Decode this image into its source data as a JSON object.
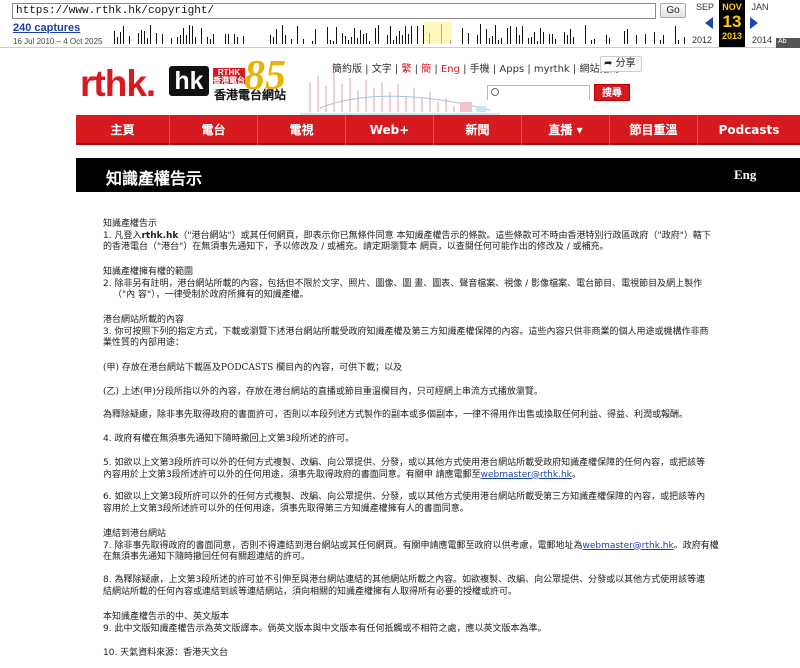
{
  "wayback": {
    "url": "https://www.rthk.hk/copyright/",
    "go_label": "Go",
    "captures": "240 captures",
    "range": "16 Jul 2010 – 4 Oct 2025",
    "prev_month": "SEP",
    "current_month": "NOV",
    "next_month": "JAN",
    "prev_year": "2012",
    "current_day": "13",
    "current_year": "2013",
    "next_year": "2014",
    "about_label": "Ab"
  },
  "header": {
    "logo_text": "rthk.",
    "logo_hk": "hk",
    "logo_badge": "RTHK 香港電台",
    "logo_zh": "香港電台網站",
    "anniversary": "85",
    "toplinks": [
      "簡約版",
      "文字",
      "繁",
      "簡",
      "Eng",
      "手機",
      "Apps",
      "myrthk",
      "網站指南"
    ],
    "share_label": "分享",
    "search_placeholder": "",
    "search_button": "搜尋"
  },
  "nav": [
    {
      "label": "主頁"
    },
    {
      "label": "電台"
    },
    {
      "label": "電視"
    },
    {
      "label": "Web+"
    },
    {
      "label": "新聞"
    },
    {
      "label": "直播 ▾"
    },
    {
      "label": "節目重溫"
    },
    {
      "label": "Podcasts"
    }
  ],
  "page": {
    "title": "知識產權告示",
    "eng_link": "Eng"
  },
  "content": {
    "s1_head": "知識產權告示",
    "s1_line1_pre": "1. 凡登入",
    "s1_line1_bold": "rthk.hk",
    "s1_line1_post": "（\"港台網站\"）或其任何網頁，即表示你已無條件同意 本知識產權告示的條款。這些條款可不時由香港特別行政區政府（\"政府\"）轄下",
    "s1_line2": "的香港電台（\"港台\"）在無須事先通知下，予以修改及 / 或補充。請定期瀏覽本 網頁，以查閱任何可能作出的修改及 / 或補充。",
    "s2_head": "知識產權擁有權的範圍",
    "s2_line1": "2. 除非另有註明，港台網站所載的內容，包括但不限於文字、照片、圖像、圖 畫、圖表、聲音檔案、視像 / 影像檔案、電台節目、電視節目及網上製作",
    "s2_line2": "（\"內 容\"），一律受制於政府所擁有的知識產權。",
    "s3_head": "港台網站所載的內容",
    "s3_line1": "3. 你可按照下列的指定方式，下載或瀏覽下述港台網站所載受政府知識產權及第三方知識產權保障的內容。這些內容只供非商業的個人用途或機構作非商",
    "s3_line2": "業性質的內部用途：",
    "s3_a": "(甲) 存放在港台網站下載區及PODCASTS 欄目內的內容，可供下載；以及",
    "s3_b": "(乙) 上述(甲)分段所指以外的內容，存放在港台網站的直播或節目重溫欄目內，只可經網上串流方式播放瀏覽。",
    "s3_c": "為釋除疑慮，除非事先取得政府的書面許可，否則以本段列述方式製作的副本或多個副本，一律不得用作出售或換取任何利益、得益、利潤或報酬。",
    "s4": "4. 政府有權在無須事先通知下隨時撤回上文第3段所述的許可。",
    "s5_line1": "5. 如欲以上文第3段所許可以外的任何方式複製、改編、向公眾提供、分發，或以其他方式使用港台網站所載受政府知識產權保障的任何內容，或把該等",
    "s5_line2_pre": "內容用於上文第3段所述許可以外的任何用途，須事先取得政府的書面同意。有關申 請應電郵至",
    "s5_email": "webmaster@rthk.hk",
    "s5_line2_post": "。",
    "s6_line1": "6. 如欲以上文第3段所許可以外的任何方式複製、改編、向公眾提供、分發，或以其他方式使用港台網站所載受第三方知識產權保障的內容，或把該等內",
    "s6_line2": "容用於上文第3段所述許可以外的任何用途，須事先取得第三方知識產權擁有人的書面同意。",
    "s7_head": "連結到港台網站",
    "s7_line1_pre": "7. 除非事先取得政府的書面同意，否則不得連結到港台網站或其任何網頁。有關申請應電郵至政府以供考慮，電郵地址為",
    "s7_email": "webmaster@rthk.hk",
    "s7_line1_post": "。政府有權",
    "s7_line2": "在無須事先通知下隨時撤回任何有關超連結的許可。",
    "s8_line1": "8. 為釋除疑慮，上文第3段所述的許可並不引伸至與港台網站連結的其他網站所載之內容。如欲複製、改編、向公眾提供、分發或以其他方式使用該等連",
    "s8_line2": "結網站所載的任何內容或連結到該等連結網站，須向相關的知識產權擁有人取得所有必要的授權或許可。",
    "s9_head": "本知識產權告示的中、英文版本",
    "s9_line1": "9. 此中文版知識產權告示為英文版譯本。倘英文版本與中文版本有任何抵觸或不相符之處，應以英文版本為準。",
    "s10": "10. 天氣資料來源：香港天文台"
  },
  "colors": {
    "brand_red": "#d71a20",
    "title_bar": "#000000",
    "link": "#1a3fa8",
    "anniversary_gold": "#e9b300"
  }
}
